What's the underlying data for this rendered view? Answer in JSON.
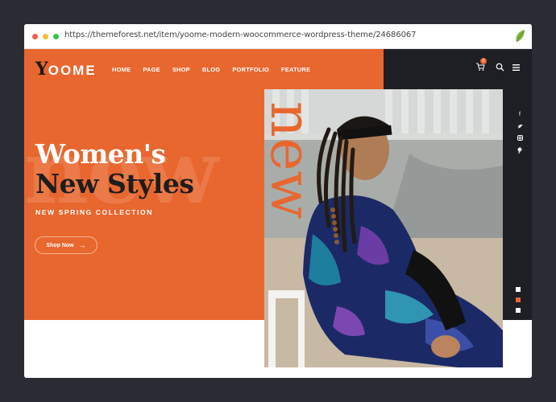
{
  "browser": {
    "url": "https://themeforest.net/item/yoome-modern-woocommerce-wordpress-theme/24686067"
  },
  "site": {
    "logo": {
      "initial": "Y",
      "rest": "OOME"
    },
    "nav": [
      "HOME",
      "PAGE",
      "SHOP",
      "BLOG",
      "PORTFOLIO",
      "FEATURE"
    ],
    "cart_count": "0",
    "hero": {
      "background_word": "new",
      "vertical_word": "new",
      "headline_1": "Women's",
      "headline_2": "New Styles",
      "subheading": "NEW SPRING COLLECTION",
      "button_label": "Shop Now",
      "button_arrow": "→"
    },
    "social": [
      "f",
      "t",
      "ig",
      "p"
    ],
    "slider_dots": 3,
    "active_slide": 2
  },
  "colors": {
    "brand_orange": "#e8672f",
    "dark": "#1e1f24",
    "accent_dot": "#e8672f"
  }
}
